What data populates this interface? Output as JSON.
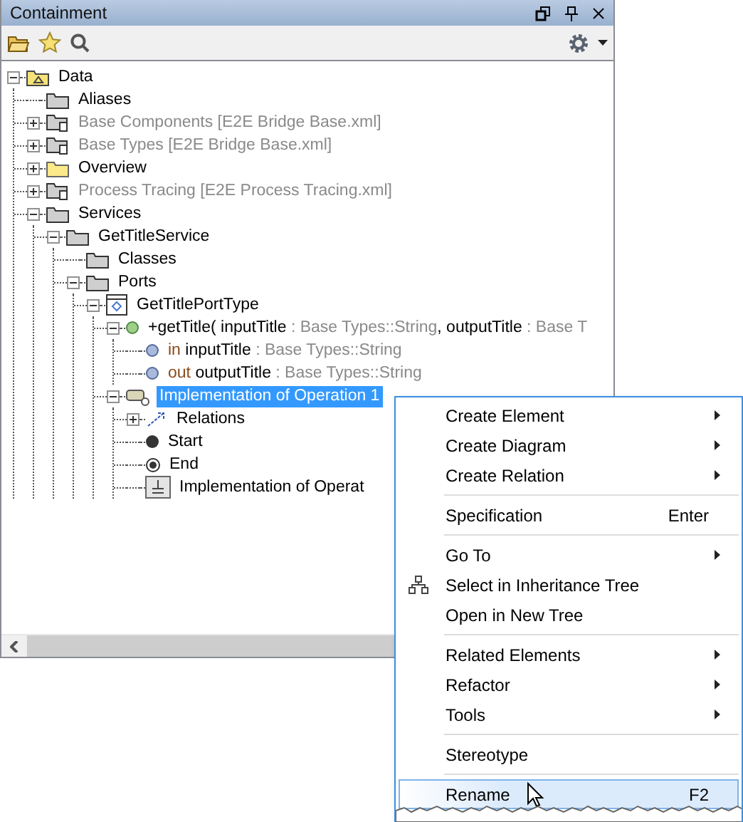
{
  "window": {
    "title": "Containment"
  },
  "tree": [
    {
      "kind": "model",
      "expanded": true,
      "selected": false,
      "label": [
        {
          "text": "Data",
          "kind": "normal"
        }
      ],
      "children": [
        {
          "kind": "folder",
          "selected": false,
          "label": [
            {
              "text": "Aliases",
              "kind": "normal"
            }
          ]
        },
        {
          "kind": "linked-folder",
          "expanded": false,
          "selected": false,
          "label": [
            {
              "text": "Base Components [E2E Bridge Base.xml]",
              "kind": "muted"
            }
          ]
        },
        {
          "kind": "linked-folder",
          "expanded": false,
          "selected": false,
          "label": [
            {
              "text": "Base Types [E2E Bridge Base.xml]",
              "kind": "muted"
            }
          ]
        },
        {
          "kind": "yellow-folder",
          "expanded": false,
          "selected": false,
          "label": [
            {
              "text": "Overview",
              "kind": "normal"
            }
          ]
        },
        {
          "kind": "linked-folder",
          "expanded": false,
          "selected": false,
          "label": [
            {
              "text": "Process Tracing [E2E Process Tracing.xml]",
              "kind": "muted"
            }
          ]
        },
        {
          "kind": "folder",
          "expanded": true,
          "selected": false,
          "label": [
            {
              "text": "Services",
              "kind": "normal"
            }
          ],
          "children": [
            {
              "kind": "folder",
              "expanded": true,
              "selected": false,
              "label": [
                {
                  "text": "GetTitleService",
                  "kind": "normal"
                }
              ],
              "children": [
                {
                  "kind": "folder",
                  "selected": false,
                  "label": [
                    {
                      "text": "Classes",
                      "kind": "normal"
                    }
                  ]
                },
                {
                  "kind": "folder",
                  "expanded": true,
                  "selected": false,
                  "label": [
                    {
                      "text": "Ports",
                      "kind": "normal"
                    }
                  ],
                  "children": [
                    {
                      "kind": "interface",
                      "expanded": true,
                      "selected": false,
                      "label": [
                        {
                          "text": "GetTitlePortType",
                          "kind": "normal"
                        }
                      ],
                      "children": [
                        {
                          "kind": "operation",
                          "expanded": true,
                          "selected": false,
                          "label": [
                            {
                              "text": "+getTitle( inputTitle",
                              "kind": "normal"
                            },
                            {
                              "text": " : Base Types::String",
                              "kind": "muted"
                            },
                            {
                              "text": ", outputTitle",
                              "kind": "normal"
                            },
                            {
                              "text": " : Base T",
                              "kind": "muted"
                            }
                          ],
                          "children": [
                            {
                              "kind": "parameter",
                              "selected": false,
                              "label": [
                                {
                                  "text": "in",
                                  "kind": "keyword"
                                },
                                {
                                  "text": " inputTitle",
                                  "kind": "normal"
                                },
                                {
                                  "text": " : Base Types::String",
                                  "kind": "muted"
                                }
                              ]
                            },
                            {
                              "kind": "parameter",
                              "selected": false,
                              "label": [
                                {
                                  "text": "out",
                                  "kind": "keyword"
                                },
                                {
                                  "text": " outputTitle",
                                  "kind": "normal"
                                },
                                {
                                  "text": " : Base Types::String",
                                  "kind": "muted"
                                }
                              ]
                            }
                          ]
                        },
                        {
                          "kind": "implementation",
                          "expanded": true,
                          "selected": true,
                          "label": [
                            {
                              "text": "Implementation of Operation 1",
                              "kind": "normal"
                            }
                          ],
                          "children": [
                            {
                              "kind": "relations",
                              "expanded": false,
                              "selected": false,
                              "label": [
                                {
                                  "text": "Relations",
                                  "kind": "normal"
                                }
                              ]
                            },
                            {
                              "kind": "start",
                              "selected": false,
                              "label": [
                                {
                                  "text": "Start",
                                  "kind": "normal"
                                }
                              ]
                            },
                            {
                              "kind": "end",
                              "selected": false,
                              "label": [
                                {
                                  "text": "End",
                                  "kind": "normal"
                                }
                              ]
                            },
                            {
                              "kind": "diagram",
                              "selected": false,
                              "label": [
                                {
                                  "text": "Implementation of Operat",
                                  "kind": "normal"
                                }
                              ]
                            }
                          ]
                        }
                      ]
                    }
                  ]
                }
              ]
            }
          ]
        }
      ]
    }
  ],
  "context_menu": {
    "groups": [
      [
        {
          "label": "Create Element",
          "submenu": true,
          "selected": false
        },
        {
          "label": "Create Diagram",
          "submenu": true,
          "selected": false
        },
        {
          "label": "Create Relation",
          "submenu": true,
          "selected": false
        }
      ],
      [
        {
          "label": "Specification",
          "shortcut": "Enter",
          "submenu": false,
          "selected": false
        }
      ],
      [
        {
          "label": "Go To",
          "submenu": true,
          "selected": false
        },
        {
          "label": "Select in Inheritance Tree",
          "kind": "hierarchy",
          "submenu": false,
          "selected": false
        },
        {
          "label": "Open in New Tree",
          "submenu": false,
          "selected": false
        }
      ],
      [
        {
          "label": "Related Elements",
          "submenu": true,
          "selected": false
        },
        {
          "label": "Refactor",
          "submenu": true,
          "selected": false
        },
        {
          "label": "Tools",
          "submenu": true,
          "selected": false
        }
      ],
      [
        {
          "label": "Stereotype",
          "submenu": false,
          "selected": false
        }
      ],
      [
        {
          "label": "Rename",
          "shortcut": "F2",
          "submenu": false,
          "selected": true
        }
      ]
    ]
  }
}
